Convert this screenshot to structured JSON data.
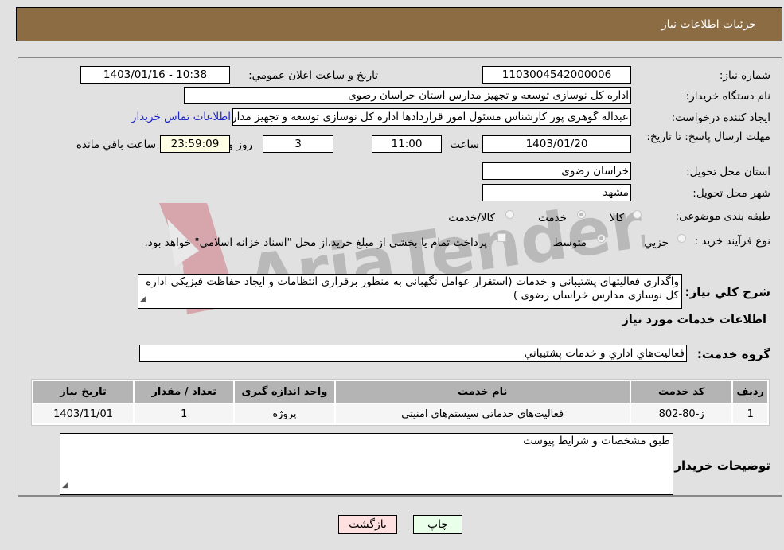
{
  "header": {
    "title": "جزئیات اطلاعات نیاز"
  },
  "form": {
    "need_number": {
      "label": "شماره نیاز:",
      "value": "1103004542000006"
    },
    "announce_datetime": {
      "label": "تاريخ و ساعت اعلان عمومي:",
      "value": "1403/01/16 - 10:38"
    },
    "buyer_org": {
      "label": "نام دستگاه خريدار:",
      "value": "اداره کل نوسازی  توسعه و تجهیز مدارس استان خراسان رضوی"
    },
    "requester": {
      "label": "ايجاد کننده درخواست:",
      "value": "عبداله گوهری پور کارشناس مسئول امور قراردادها  اداره کل نوسازی  توسعه و تجهیز مدارس استان خراسان رضوی"
    },
    "buyer_contact_link": "اطلاعات تماس خريدار",
    "deadline": {
      "label": "مهلت ارسال پاسخ: تا تاریخ:",
      "date": "1403/01/20",
      "time_label": "ساعت",
      "time": "11:00",
      "days": "3",
      "days_label": "روز و",
      "remaining": "23:59:09",
      "remaining_label": "ساعت باقي مانده"
    },
    "delivery_province": {
      "label": "استان محل تحويل:",
      "value": "خراسان رضوی"
    },
    "delivery_city": {
      "label": "شهر محل تحويل:",
      "value": "مشهد"
    },
    "category": {
      "label": "طبقه بندی موضوعی:",
      "options": [
        {
          "label": "کالا",
          "checked": false
        },
        {
          "label": "خدمت",
          "checked": true
        },
        {
          "label": "کالا/خدمت",
          "checked": false
        }
      ]
    },
    "purchase_process": {
      "label": "نوع فرآيند خريد :",
      "options": [
        {
          "label": "جزيي",
          "checked": false
        },
        {
          "label": "متوسط",
          "checked": true
        }
      ],
      "treasury_checkbox": {
        "label": "پرداخت تمام يا بخشی از مبلغ خريد،از محل \"اسناد خزانه اسلامی\" خواهد بود.",
        "checked": false
      }
    },
    "description": {
      "label": "شرح کلي نياز:",
      "value": "واگذاری فعالیتهای پشتیبانی و خدمات (استقرار عوامل نگهبانی به منظور برقراری انتظامات و ایجاد حفاظت فیزیکی اداره کل نوسازی مدارس خراسان رضوی )"
    },
    "services_section_title": "اطلاعات خدمات مورد نياز",
    "service_group": {
      "label": "گروه خدمت:",
      "value": "فعاليت‌هاي اداري و خدمات پشتيباني"
    }
  },
  "table": {
    "headers": [
      "رديف",
      "کد خدمت",
      "نام خدمت",
      "واحد اندازه گيری",
      "تعداد / مقدار",
      "تاريخ نياز"
    ],
    "rows": [
      [
        "1",
        "ز-80-802",
        "فعالیت‌های خدماتی سیستم‌های امنیتی",
        "پروژه",
        "1",
        "1403/11/01"
      ]
    ]
  },
  "buyer_notes": {
    "label": "توضيحات خريدار:",
    "value": "طبق مشخصات و شرايط پيوست"
  },
  "buttons": {
    "print": "چاپ",
    "back": "بازگشت"
  },
  "watermark": {
    "text": "AriaTender.neT"
  }
}
